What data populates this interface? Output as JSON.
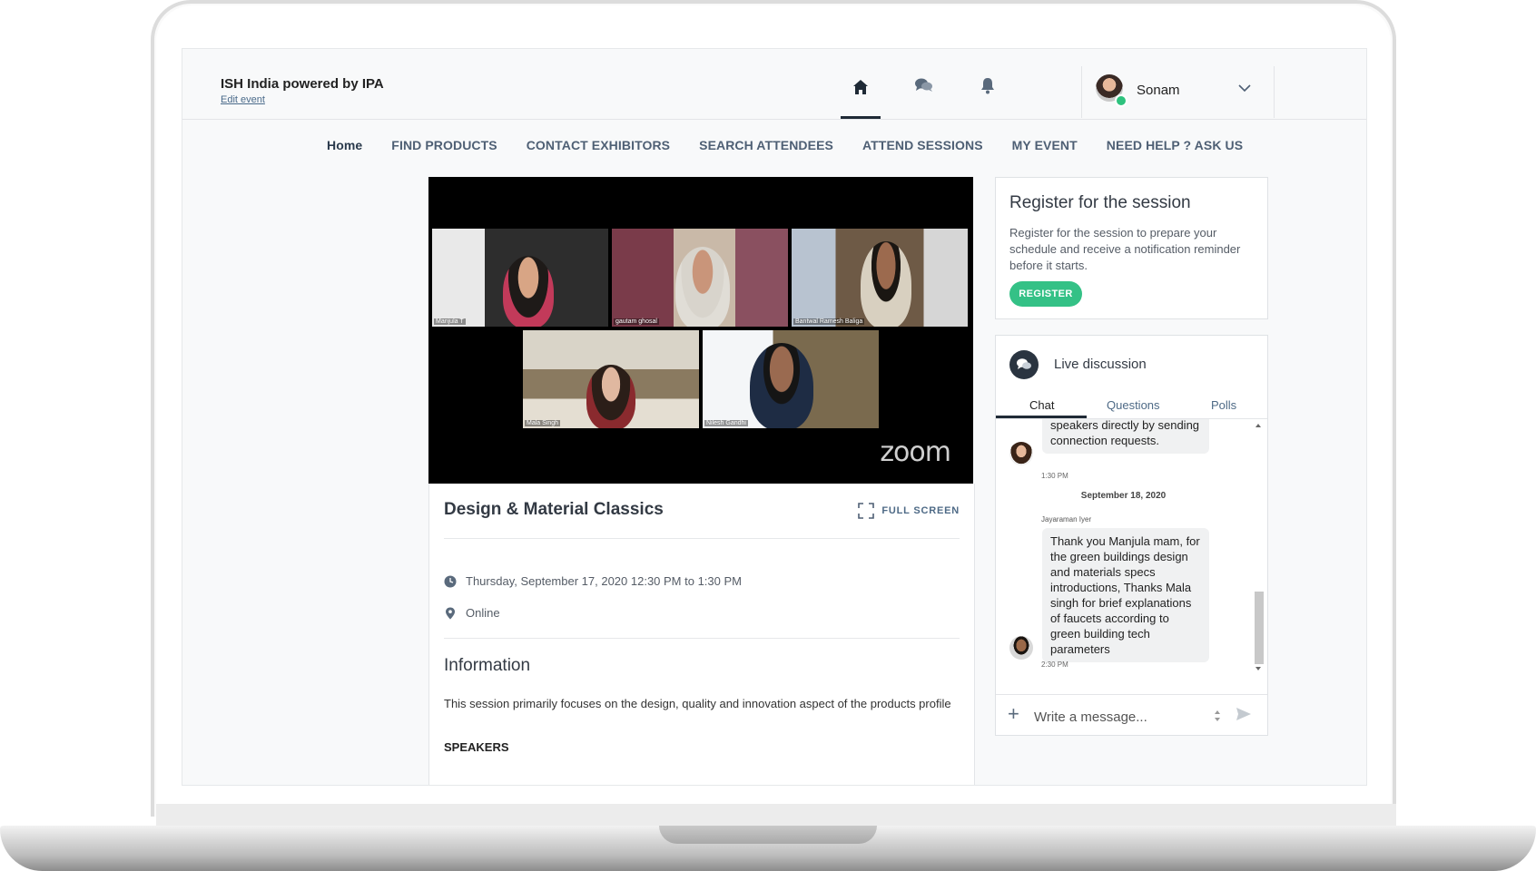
{
  "header": {
    "brand": "ISH India powered by IPA",
    "edit_event": "Edit event",
    "user_name": "Sonam",
    "icons": [
      "home-icon",
      "chat-icon",
      "bell-icon",
      "chevron-down-icon"
    ]
  },
  "menu": {
    "items": [
      "Home",
      "FIND PRODUCTS",
      "CONTACT EXHIBITORS",
      "SEARCH ATTENDEES",
      "ATTEND SESSIONS",
      "MY EVENT",
      "NEED HELP ? ASK US"
    ]
  },
  "video": {
    "participants": [
      "Manjula T",
      "gautam ghosal",
      "Bantwal Ramesh Baliga",
      "Mala Singh",
      "Nilesh Gandhi"
    ],
    "logo": "zoom"
  },
  "session": {
    "title": "Design & Material Classics",
    "fullscreen_label": "FULL SCREEN",
    "datetime": "Thursday, September 17, 2020 12:30 PM to 1:30 PM",
    "location": "Online",
    "info_heading": "Information",
    "info_text": "This session primarily focuses on the design, quality and innovation aspect of the products profile",
    "speakers_heading": "SPEAKERS"
  },
  "register": {
    "title": "Register for the session",
    "text": "Register for the session to prepare your schedule and receive a notification reminder before it starts.",
    "button": "REGISTER"
  },
  "discussion": {
    "title": "Live discussion",
    "tabs": [
      "Chat",
      "Questions",
      "Polls"
    ],
    "messages": [
      {
        "text": "speakers directly by sending connection requests.",
        "time": "1:30 PM"
      },
      {
        "date": "September 18, 2020"
      },
      {
        "sender": "Jayaraman Iyer",
        "text": "Thank you Manjula mam, for the green buildings design and materials specs introductions, Thanks Mala singh for brief explanations of faucets according to green building tech parameters",
        "time": "2:30 PM"
      }
    ],
    "compose_placeholder": "Write a message..."
  },
  "colors": {
    "accent_green": "#34c186",
    "nav_text": "#4e5f74",
    "online": "#2ec27e"
  }
}
